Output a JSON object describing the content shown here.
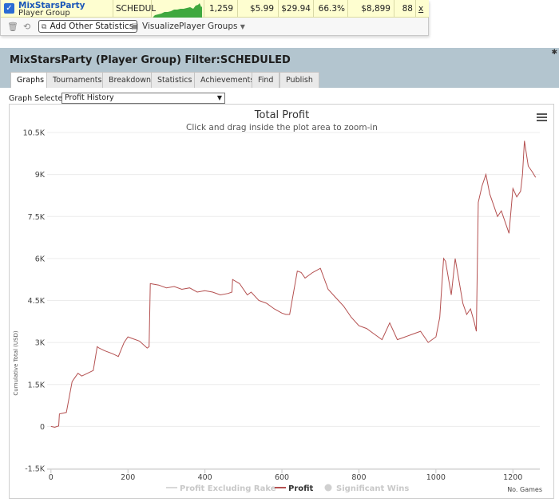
{
  "summary": {
    "player_name": "MixStarsParty",
    "player_type": "Player Group",
    "filter": "SCHEDUL",
    "games": "1,259",
    "avg_buyin": "$5.99",
    "avg_profit": "$29.94",
    "itm": "66.3%",
    "profit": "$8,899",
    "stat": "88",
    "close": "x",
    "checked": true
  },
  "toolbar": {
    "add_stats_label": "Add Other Statistics",
    "visualize_label": "Visualize",
    "player_groups_label": "Player Groups"
  },
  "panel": {
    "title": "MixStarsParty (Player Group) Filter:SCHEDULED",
    "tabs": [
      "Graphs",
      "Tournaments",
      "Breakdown",
      "Statistics",
      "Achievements",
      "Find",
      "Publish"
    ],
    "active_tab": "Graphs",
    "graph_selected_label": "Graph Selected:",
    "graph_selected_value": "Profit History"
  },
  "colors": {
    "profit_line": "#b45050",
    "header_bg": "#b3c5cf",
    "sparkline": "#3fa83f"
  },
  "chart_data": {
    "type": "line",
    "title": "Total Profit",
    "subtitle": "Click and drag inside the plot area to zoom-in",
    "ylabel": "Cumulative Total (USD)",
    "xlabel": "No. Games",
    "xlim": [
      -10,
      1270
    ],
    "ylim": [
      -1500,
      10500
    ],
    "xticks": [
      0,
      200,
      400,
      600,
      800,
      1000,
      1200
    ],
    "yticks": [
      -1500,
      0,
      1500,
      3000,
      4500,
      6000,
      7500,
      9000,
      10500
    ],
    "ytick_labels": [
      "-1.5K",
      "0",
      "1.5K",
      "3K",
      "4.5K",
      "6K",
      "7.5K",
      "9K",
      "10.5K"
    ],
    "legend": [
      {
        "name": "Profit Excluding Rake",
        "visible": false
      },
      {
        "name": "Profit",
        "visible": true
      },
      {
        "name": "Significant Wins",
        "visible": false
      }
    ],
    "series": [
      {
        "name": "Profit",
        "x": [
          0,
          10,
          20,
          22,
          40,
          55,
          60,
          70,
          80,
          95,
          110,
          120,
          125,
          140,
          160,
          175,
          190,
          200,
          210,
          230,
          250,
          255,
          258,
          280,
          300,
          320,
          340,
          360,
          380,
          400,
          420,
          440,
          460,
          470,
          472,
          490,
          510,
          520,
          540,
          560,
          580,
          600,
          610,
          620,
          640,
          650,
          660,
          680,
          700,
          720,
          740,
          760,
          780,
          800,
          820,
          840,
          860,
          880,
          900,
          920,
          940,
          960,
          980,
          1000,
          1010,
          1020,
          1025,
          1030,
          1040,
          1050,
          1060,
          1070,
          1080,
          1090,
          1100,
          1105,
          1110,
          1120,
          1130,
          1140,
          1150,
          1160,
          1170,
          1180,
          1190,
          1200,
          1210,
          1215,
          1220,
          1225,
          1230,
          1240,
          1250,
          1259
        ],
        "y": [
          0,
          -30,
          20,
          450,
          500,
          1600,
          1700,
          1900,
          1800,
          1900,
          2000,
          2850,
          2800,
          2700,
          2600,
          2500,
          3000,
          3200,
          3150,
          3050,
          2800,
          2850,
          5100,
          5050,
          4950,
          5000,
          4900,
          4950,
          4800,
          4850,
          4800,
          4700,
          4750,
          4800,
          5250,
          5100,
          4700,
          4800,
          4500,
          4400,
          4200,
          4050,
          4000,
          4000,
          5550,
          5500,
          5300,
          5500,
          5650,
          4900,
          4600,
          4300,
          3900,
          3600,
          3500,
          3300,
          3100,
          3700,
          3100,
          3200,
          3300,
          3400,
          3000,
          3200,
          3900,
          6000,
          5900,
          5500,
          4700,
          6000,
          5200,
          4400,
          4000,
          4200,
          3700,
          3400,
          8000,
          8600,
          9000,
          8300,
          7900,
          7500,
          7700,
          7300,
          6900,
          8500,
          8200,
          8300,
          8400,
          9000,
          10200,
          9300,
          9100,
          8899
        ]
      }
    ]
  }
}
